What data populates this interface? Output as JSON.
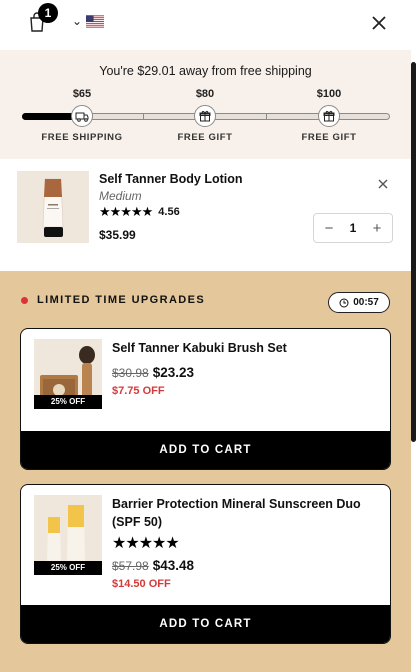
{
  "header": {
    "cart_count": "1",
    "cart_icon": "shopping-bag-icon",
    "locale_flag": "us-flag-icon",
    "close_icon": "close-icon"
  },
  "shipping": {
    "message": "You're $29.01 away from free shipping",
    "progress": 0.15,
    "milestones": [
      {
        "amount": "$65",
        "label": "FREE SHIPPING",
        "icon": "truck-icon"
      },
      {
        "amount": "$80",
        "label": "FREE GIFT",
        "icon": "gift-icon"
      },
      {
        "amount": "$100",
        "label": "FREE GIFT",
        "icon": "gift-icon"
      }
    ]
  },
  "cart_item": {
    "title": "Self Tanner Body Lotion",
    "variant": "Medium",
    "stars": "★★★★★",
    "rating": "4.56",
    "price": "$35.99",
    "quantity": "1",
    "minus": "−",
    "plus": "+"
  },
  "upgrades": {
    "title": "LIMITED TIME UPGRADES",
    "timer": "00:57",
    "items": [
      {
        "title": "Self Tanner Kabuki Brush Set",
        "badge": "25% OFF",
        "old_price": "$30.98",
        "new_price": "$23.23",
        "savings": "$7.75 OFF",
        "button": "ADD TO CART"
      },
      {
        "title": "Barrier Protection Mineral Sunscreen Duo (SPF 50)",
        "badge": "25% OFF",
        "stars": "★★★★★",
        "old_price": "$57.98",
        "new_price": "$43.48",
        "savings": "$14.50 OFF",
        "button": "ADD TO CART"
      }
    ]
  },
  "colors": {
    "shipping_bg": "#f8f0ea",
    "upgrades_bg": "#e4c79b",
    "savings_red": "#d43a3a",
    "accent_dot": "#d8343a"
  }
}
